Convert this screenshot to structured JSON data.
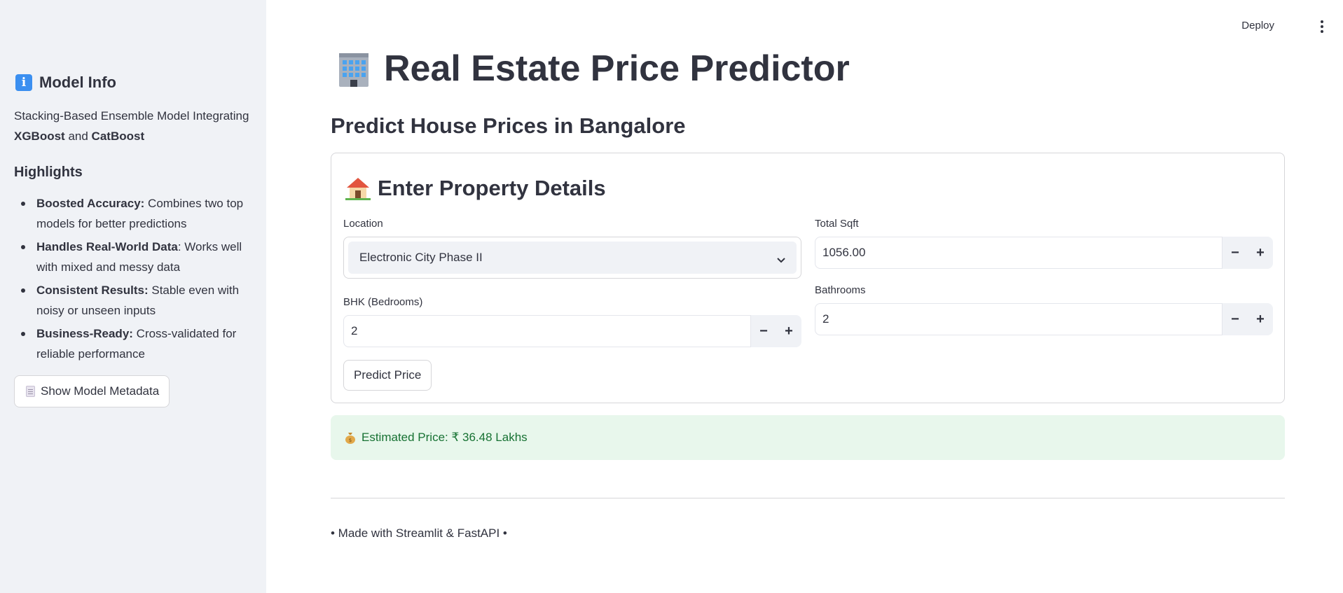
{
  "header": {
    "deploy_label": "Deploy",
    "menu_icon": "kebab-menu-icon"
  },
  "sidebar": {
    "title": "Model Info",
    "title_icon": "info-icon",
    "desc_prefix": "Stacking-Based Ensemble Model Integrating ",
    "desc_model1": "XGBoost",
    "desc_and": " and ",
    "desc_model2": "CatBoost",
    "highlights_heading": "Highlights",
    "highlights": [
      {
        "bold": "Boosted Accuracy:",
        "text": " Combines two top models for better predictions"
      },
      {
        "bold": "Handles Real-World Data",
        "text": ": Works well with mixed and messy data"
      },
      {
        "bold": "Consistent Results:",
        "text": " Stable even with noisy or unseen inputs"
      },
      {
        "bold": "Business-Ready:",
        "text": " Cross-validated for reliable performance"
      }
    ],
    "metadata_button": "Show Model Metadata",
    "metadata_icon": "document-icon"
  },
  "main": {
    "title": "Real Estate Price Predictor",
    "title_icon": "office-building-icon",
    "subtitle": "Predict House Prices in Bangalore",
    "form": {
      "title": "Enter Property Details",
      "title_icon": "house-icon",
      "location_label": "Location",
      "location_value": "Electronic City Phase II",
      "sqft_label": "Total Sqft",
      "sqft_value": "1056.00",
      "bhk_label": "BHK (Bedrooms)",
      "bhk_value": "2",
      "bath_label": "Bathrooms",
      "bath_value": "2",
      "minus": "−",
      "plus": "+",
      "submit_label": "Predict Price"
    },
    "result": {
      "icon": "money-bag-icon",
      "text": "Estimated Price: ₹ 36.48 Lakhs"
    },
    "footer": "• Made with Streamlit & FastAPI •"
  },
  "colors": {
    "sidebar_bg": "#f0f2f6",
    "text": "#31333f",
    "success_bg": "#e8f7ec",
    "success_text": "#177233",
    "info_icon_bg": "#3b8ff0"
  }
}
